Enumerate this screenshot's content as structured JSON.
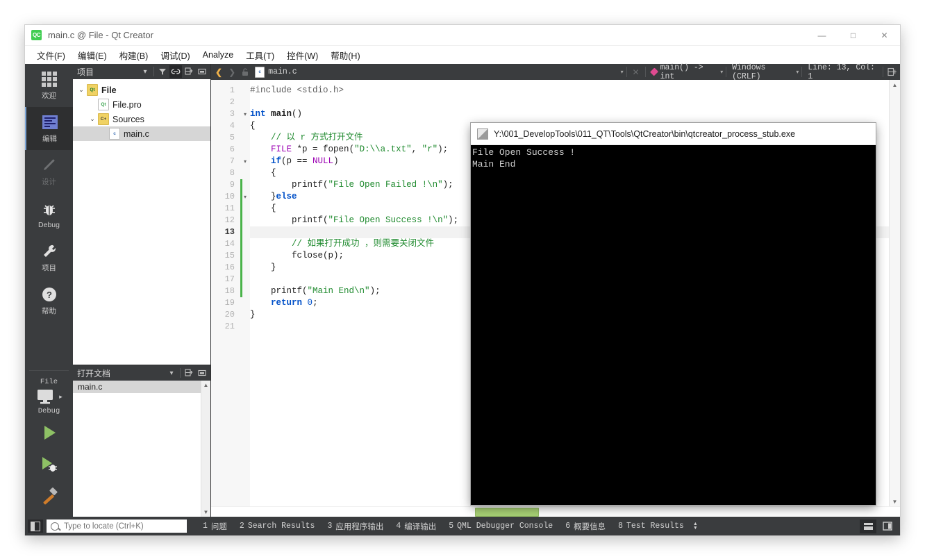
{
  "window": {
    "title": "main.c @ File - Qt Creator",
    "logo_text": "QC",
    "minimize": "—",
    "maximize": "□",
    "close": "✕"
  },
  "menubar": {
    "items": [
      {
        "label": "文件(F)"
      },
      {
        "label": "编辑(E)"
      },
      {
        "label": "构建(B)"
      },
      {
        "label": "调试(D)"
      },
      {
        "label": "Analyze"
      },
      {
        "label": "工具(T)"
      },
      {
        "label": "控件(W)"
      },
      {
        "label": "帮助(H)"
      }
    ]
  },
  "modebar": {
    "modes": [
      {
        "label": "欢迎",
        "icon": "grid-icon"
      },
      {
        "label": "编辑",
        "icon": "edit-document-icon"
      },
      {
        "label": "设计",
        "icon": "pencil-icon"
      },
      {
        "label": "Debug",
        "icon": "bug-icon"
      },
      {
        "label": "项目",
        "icon": "wrench-icon"
      },
      {
        "label": "帮助",
        "icon": "question-icon"
      }
    ],
    "kit": {
      "project_label": "File",
      "config_label": "Debug",
      "run_icon": "play-icon",
      "debug_icon": "play-bug-icon",
      "build_icon": "hammer-icon"
    }
  },
  "project_dock": {
    "title": "项目",
    "icons": [
      "chevron-down-icon",
      "filter-icon",
      "link-icon",
      "split-icon",
      "minimize-pane-icon"
    ],
    "tree": [
      {
        "label": "File",
        "icon": "qt-project-icon",
        "depth": 0,
        "expanded": true,
        "bold": true,
        "selected": false
      },
      {
        "label": "File.pro",
        "icon": "pro-file-icon",
        "depth": 1,
        "expanded": null,
        "bold": false,
        "selected": false
      },
      {
        "label": "Sources",
        "icon": "sources-folder-icon",
        "depth": 1,
        "expanded": true,
        "bold": false,
        "selected": false
      },
      {
        "label": "main.c",
        "icon": "c-file-icon",
        "depth": 2,
        "expanded": null,
        "bold": false,
        "selected": true
      }
    ]
  },
  "opendocs_dock": {
    "title": "打开文档",
    "icons": [
      "chevron-down-icon",
      "split-icon",
      "minimize-pane-icon"
    ],
    "items": [
      {
        "label": "main.c",
        "selected": true
      }
    ]
  },
  "editor_toolbar": {
    "back_icon": "back-arrow-icon",
    "forward_icon": "forward-arrow-icon",
    "lock_icon": "lock-icon",
    "file_name": "main.c",
    "file_icon": "c-file-icon",
    "close_icon": "close-icon",
    "symbol": "main() -> int",
    "symbol_icon": "function-diamond-icon",
    "line_ending": "Windows (CRLF)",
    "cursor_position": "Line: 13, Col: 1",
    "split_icon": "split-editor-icon"
  },
  "code": {
    "lines": [
      {
        "n": 1,
        "fold": "",
        "change": false,
        "current": false,
        "tokens": [
          {
            "t": "#include ",
            "c": "pp"
          },
          {
            "t": "<stdio.h>",
            "c": "pp"
          }
        ]
      },
      {
        "n": 2,
        "fold": "",
        "change": false,
        "current": false,
        "tokens": []
      },
      {
        "n": 3,
        "fold": "▾",
        "change": false,
        "current": false,
        "tokens": [
          {
            "t": "int ",
            "c": "kw"
          },
          {
            "t": "main",
            "c": "fnb"
          },
          {
            "t": "()",
            "c": ""
          }
        ]
      },
      {
        "n": 4,
        "fold": "",
        "change": false,
        "current": false,
        "tokens": [
          {
            "t": "{",
            "c": ""
          }
        ]
      },
      {
        "n": 5,
        "fold": "",
        "change": false,
        "current": false,
        "tokens": [
          {
            "t": "    ",
            "c": ""
          },
          {
            "t": "// 以 r 方式打开文件",
            "c": "cm"
          }
        ]
      },
      {
        "n": 6,
        "fold": "",
        "change": false,
        "current": false,
        "tokens": [
          {
            "t": "    ",
            "c": ""
          },
          {
            "t": "FILE",
            "c": "ty"
          },
          {
            "t": " *p = ",
            "c": ""
          },
          {
            "t": "fopen",
            "c": ""
          },
          {
            "t": "(",
            "c": ""
          },
          {
            "t": "\"D:\\\\a.txt\"",
            "c": "str"
          },
          {
            "t": ", ",
            "c": ""
          },
          {
            "t": "\"r\"",
            "c": "str"
          },
          {
            "t": ");",
            "c": ""
          }
        ]
      },
      {
        "n": 7,
        "fold": "▾",
        "change": false,
        "current": false,
        "tokens": [
          {
            "t": "    ",
            "c": ""
          },
          {
            "t": "if",
            "c": "kw"
          },
          {
            "t": "(p == ",
            "c": ""
          },
          {
            "t": "NULL",
            "c": "ty"
          },
          {
            "t": ")",
            "c": ""
          }
        ]
      },
      {
        "n": 8,
        "fold": "",
        "change": false,
        "current": false,
        "tokens": [
          {
            "t": "    {",
            "c": ""
          }
        ]
      },
      {
        "n": 9,
        "fold": "",
        "change": true,
        "current": false,
        "tokens": [
          {
            "t": "        ",
            "c": ""
          },
          {
            "t": "printf",
            "c": ""
          },
          {
            "t": "(",
            "c": ""
          },
          {
            "t": "\"File Open Failed !\\n\"",
            "c": "str"
          },
          {
            "t": ");",
            "c": ""
          }
        ]
      },
      {
        "n": 10,
        "fold": "▾",
        "change": true,
        "current": false,
        "tokens": [
          {
            "t": "    }",
            "c": ""
          },
          {
            "t": "else",
            "c": "kw"
          }
        ]
      },
      {
        "n": 11,
        "fold": "",
        "change": true,
        "current": false,
        "tokens": [
          {
            "t": "    {",
            "c": ""
          }
        ]
      },
      {
        "n": 12,
        "fold": "",
        "change": true,
        "current": false,
        "tokens": [
          {
            "t": "        ",
            "c": ""
          },
          {
            "t": "printf",
            "c": ""
          },
          {
            "t": "(",
            "c": ""
          },
          {
            "t": "\"File Open Success !\\n\"",
            "c": "str"
          },
          {
            "t": ");",
            "c": ""
          }
        ]
      },
      {
        "n": 13,
        "fold": "",
        "change": true,
        "current": true,
        "tokens": []
      },
      {
        "n": 14,
        "fold": "",
        "change": true,
        "current": false,
        "tokens": [
          {
            "t": "        ",
            "c": ""
          },
          {
            "t": "// 如果打开成功 ，则需要关闭文件",
            "c": "cm"
          }
        ]
      },
      {
        "n": 15,
        "fold": "",
        "change": true,
        "current": false,
        "tokens": [
          {
            "t": "        ",
            "c": ""
          },
          {
            "t": "fclose",
            "c": ""
          },
          {
            "t": "(p);",
            "c": ""
          }
        ]
      },
      {
        "n": 16,
        "fold": "",
        "change": true,
        "current": false,
        "tokens": [
          {
            "t": "    }",
            "c": ""
          }
        ]
      },
      {
        "n": 17,
        "fold": "",
        "change": false,
        "current": false,
        "tokens": []
      },
      {
        "n": 18,
        "fold": "",
        "change": true,
        "current": false,
        "tokens": [
          {
            "t": "    ",
            "c": ""
          },
          {
            "t": "printf",
            "c": ""
          },
          {
            "t": "(",
            "c": ""
          },
          {
            "t": "\"Main End\\n\"",
            "c": "str"
          },
          {
            "t": ");",
            "c": ""
          }
        ]
      },
      {
        "n": 19,
        "fold": "",
        "change": false,
        "current": false,
        "tokens": [
          {
            "t": "    ",
            "c": ""
          },
          {
            "t": "return",
            "c": "kw"
          },
          {
            "t": " ",
            "c": ""
          },
          {
            "t": "0",
            "c": "num"
          },
          {
            "t": ";",
            "c": ""
          }
        ]
      },
      {
        "n": 20,
        "fold": "",
        "change": false,
        "current": false,
        "tokens": [
          {
            "t": "}",
            "c": ""
          }
        ]
      },
      {
        "n": 21,
        "fold": "",
        "change": false,
        "current": false,
        "tokens": []
      }
    ]
  },
  "console": {
    "title": "Y:\\001_DevelopTools\\011_QT\\Tools\\QtCreator\\bin\\qtcreator_process_stub.exe",
    "icon": "console-window-icon",
    "output": [
      "File Open Success !",
      "Main End"
    ]
  },
  "statusbar": {
    "sidebar_toggle_icon": "toggle-sidebar-icon",
    "locator_placeholder": "Type to locate (Ctrl+K)",
    "locator_value": "",
    "locator_icon": "search-icon",
    "panes": [
      {
        "num": "1",
        "label": "问题",
        "mono": false
      },
      {
        "num": "2",
        "label": "Search Results",
        "mono": true
      },
      {
        "num": "3",
        "label": "应用程序输出",
        "mono": false
      },
      {
        "num": "4",
        "label": "编译输出",
        "mono": false
      },
      {
        "num": "5",
        "label": "QML Debugger Console",
        "mono": true
      },
      {
        "num": "6",
        "label": "概要信息",
        "mono": false
      },
      {
        "num": "8",
        "label": "Test Results",
        "mono": true
      }
    ],
    "updown_icon": "up-down-arrows-icon",
    "right_icons": [
      "output-pane-icon",
      "toggle-rightbar-icon"
    ]
  },
  "colors": {
    "accent_green": "#41cd52",
    "change_marker": "#4ab34a",
    "scroll_thumb": "#a8d175",
    "mode_active": "#7ea7d8",
    "string": "#1f8a2e",
    "keyword": "#0050c8",
    "type": "#9b00b3"
  }
}
